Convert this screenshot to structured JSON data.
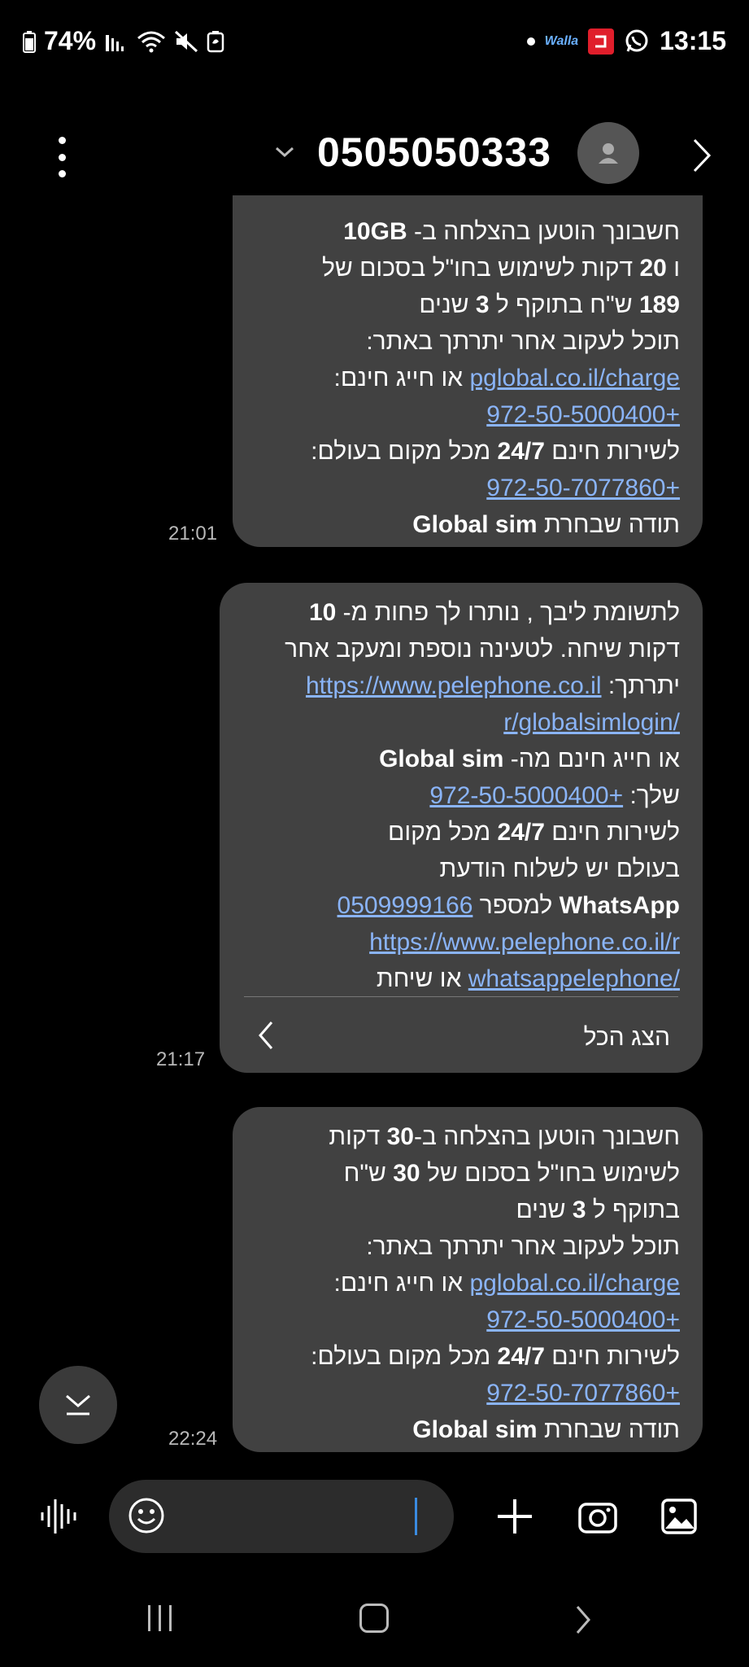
{
  "status_bar": {
    "battery_percent": "74%",
    "time": "13:15",
    "walla_label": "Walla",
    "app_icons": [
      "signal-icon",
      "wifi-icon",
      "mute-icon",
      "battery-saver-icon",
      "notification-dot-icon",
      "walla-icon",
      "channel-app-icon",
      "whatsapp-icon"
    ]
  },
  "header": {
    "title": "0505050333"
  },
  "messages": [
    {
      "lines": [
        [
          "חשבונך הוטען בהצלחה  ב-  ",
          {
            "b": "10GB"
          }
        ],
        [
          "ו ",
          {
            "b": "20"
          },
          " דקות לשימוש בחו\"ל בסכום של"
        ],
        [
          {
            "b": "189"
          },
          " ש\"ח בתוקף ל ",
          {
            "b": "3"
          },
          " שנים"
        ],
        [
          "תוכל לעקוב אחר יתרתך באתר:"
        ],
        [
          {
            "a": "pglobal.co.il/charge"
          },
          " או חייג חינם:"
        ],
        [
          {
            "a": "+972-50-5000400"
          }
        ],
        [
          "לשירות חינם ",
          {
            "b": "24/7"
          },
          " מכל מקום בעולם:"
        ],
        [
          {
            "a": "+972-50-7077860"
          }
        ],
        [
          "תודה שבחרת ",
          {
            "b": "Global sim"
          }
        ]
      ],
      "time": "21:01"
    },
    {
      "lines": [
        [
          "לתשומת ליבך , נותרו לך פחות מ- ",
          {
            "b": "10"
          }
        ],
        [
          "דקות שיחה. לטעינה נוספת ומעקב אחר"
        ],
        [
          "יתרתך:  ",
          {
            "a": "https://www.pelephone.co.il"
          }
        ],
        [
          {
            "a": "/r/globalsimlogin"
          }
        ],
        [
          "או חייג חינם מה- ",
          {
            "b": "Global sim"
          }
        ],
        [
          "שלך:  ",
          {
            "a": "+972-50-5000400"
          }
        ],
        [
          "לשירות חינם ",
          {
            "b": "24/7"
          },
          " מכל מקום"
        ],
        [
          "בעולם יש לשלוח הודעת"
        ],
        [
          {
            "b": "WhatsApp"
          },
          "  למספר ",
          {
            "a": "0509999166"
          }
        ],
        [
          {
            "a": "https://www.pelephone.co.il/r"
          }
        ],
        [
          {
            "a": "/whatsappelephone"
          },
          " או שיחת"
        ]
      ],
      "show_all": "הצג הכל",
      "time": "21:17"
    },
    {
      "lines": [
        [
          "חשבונך הוטען בהצלחה  ב-",
          {
            "b": "30"
          },
          " דקות"
        ],
        [
          "לשימוש בחו\"ל בסכום של  ",
          {
            "b": "30"
          },
          " ש\"ח"
        ],
        [
          "בתוקף ל ",
          {
            "b": "3"
          },
          " שנים"
        ],
        [
          "תוכל לעקוב אחר יתרתך באתר:"
        ],
        [
          {
            "a": "pglobal.co.il/charge"
          },
          " או חייג חינם:"
        ],
        [
          {
            "a": "+972-50-5000400"
          }
        ],
        [
          "לשירות חינם ",
          {
            "b": "24/7"
          },
          " מכל מקום בעולם:"
        ],
        [
          {
            "a": "+972-50-7077860"
          }
        ],
        [
          "תודה שבחרת ",
          {
            "b": "Global sim"
          }
        ]
      ],
      "time": "22:24"
    }
  ],
  "composer": {
    "placeholder": ""
  },
  "colors": {
    "bubble": "#414141",
    "link": "#8ab4f8",
    "background": "#000000",
    "cursor": "#3a8be0"
  }
}
